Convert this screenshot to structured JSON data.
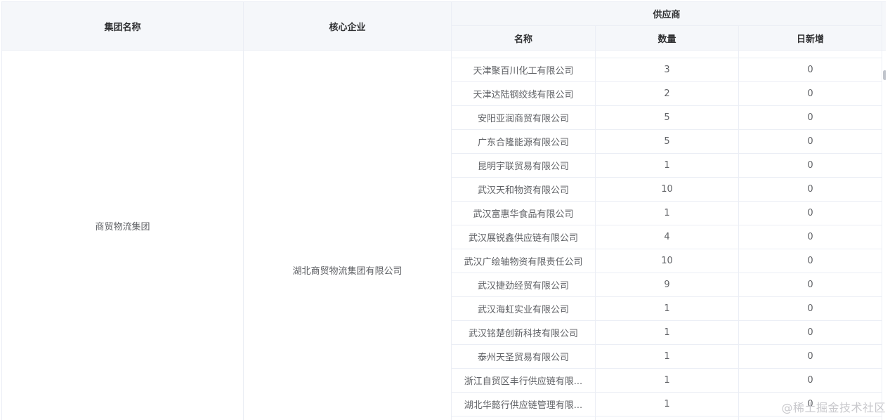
{
  "table": {
    "headers": {
      "group": "集团名称",
      "core": "核心企业",
      "supplier": "供应商",
      "name": "名称",
      "count": "数量",
      "daily": "日新增"
    },
    "group_name": "商贸物流集团",
    "core_company": "湖北商贸物流集团有限公司",
    "rows": [
      {
        "name": "天津聚百川化工有限公司",
        "count": "3",
        "daily": "0"
      },
      {
        "name": "天津达陆钢绞线有限公司",
        "count": "2",
        "daily": "0"
      },
      {
        "name": "安阳亚润商贸有限公司",
        "count": "5",
        "daily": "0"
      },
      {
        "name": "广东合隆能源有限公司",
        "count": "5",
        "daily": "0"
      },
      {
        "name": "昆明宇联贸易有限公司",
        "count": "1",
        "daily": "0"
      },
      {
        "name": "武汉天和物资有限公司",
        "count": "10",
        "daily": "0"
      },
      {
        "name": "武汉富惠华食品有限公司",
        "count": "1",
        "daily": "0"
      },
      {
        "name": "武汉展锐鑫供应链有限公司",
        "count": "4",
        "daily": "0"
      },
      {
        "name": "武汉广绘轴物资有限责任公司",
        "count": "10",
        "daily": "0"
      },
      {
        "name": "武汉捷劲经贸有限公司",
        "count": "9",
        "daily": "0"
      },
      {
        "name": "武汉海虹实业有限公司",
        "count": "1",
        "daily": "0"
      },
      {
        "name": "武汉铭楚创新科技有限公司",
        "count": "1",
        "daily": "0"
      },
      {
        "name": "泰州天圣贸易有限公司",
        "count": "1",
        "daily": "0"
      },
      {
        "name": "浙江自贸区丰行供应链有限...",
        "count": "1",
        "daily": "0"
      },
      {
        "name": "湖北华懿行供应链管理有限...",
        "count": "1",
        "daily": "0"
      }
    ]
  },
  "watermark": "@稀土掘金技术社区"
}
